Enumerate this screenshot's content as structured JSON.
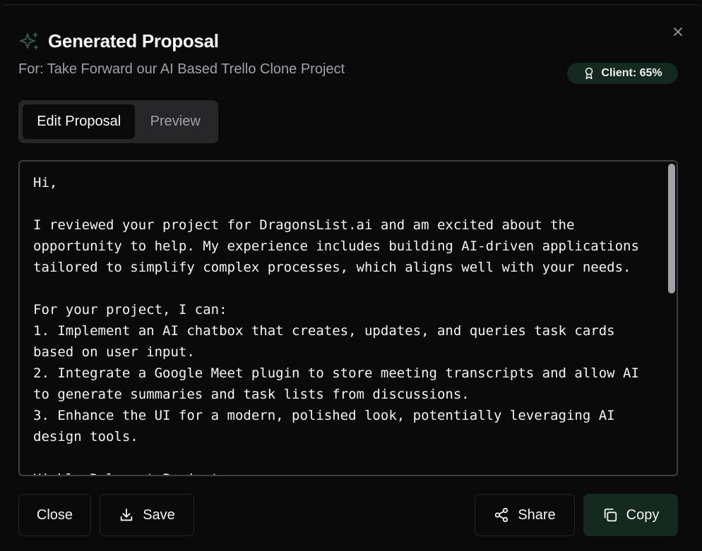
{
  "dialog": {
    "title": "Generated Proposal",
    "subtitle": "For: Take Forward our AI Based Trello Clone Project",
    "client_badge": "Client: 65%",
    "close_icon": "x-icon",
    "title_icon": "sparkles-icon"
  },
  "tabs": [
    {
      "label": "Edit Proposal",
      "active": true
    },
    {
      "label": "Preview",
      "active": false
    }
  ],
  "editor": {
    "content": "Hi,\n\nI reviewed your project for DragonsList.ai and am excited about the opportunity to help. My experience includes building AI-driven applications tailored to simplify complex processes, which aligns well with your needs.\n\nFor your project, I can:\n1. Implement an AI chatbox that creates, updates, and queries task cards based on user input.\n2. Integrate a Google Meet plugin to store meeting transcripts and allow AI to generate summaries and task lists from discussions.\n3. Enhance the UI for a modern, polished look, potentially leveraging AI design tools.\n\nHighly Relevant Project:"
  },
  "actions": {
    "close_label": "Close",
    "save_label": "Save",
    "share_label": "Share",
    "copy_label": "Copy"
  },
  "colors": {
    "accent_green": "#14291f",
    "sparkle_green": "#2f5a44",
    "background": "#0a0a0b"
  }
}
